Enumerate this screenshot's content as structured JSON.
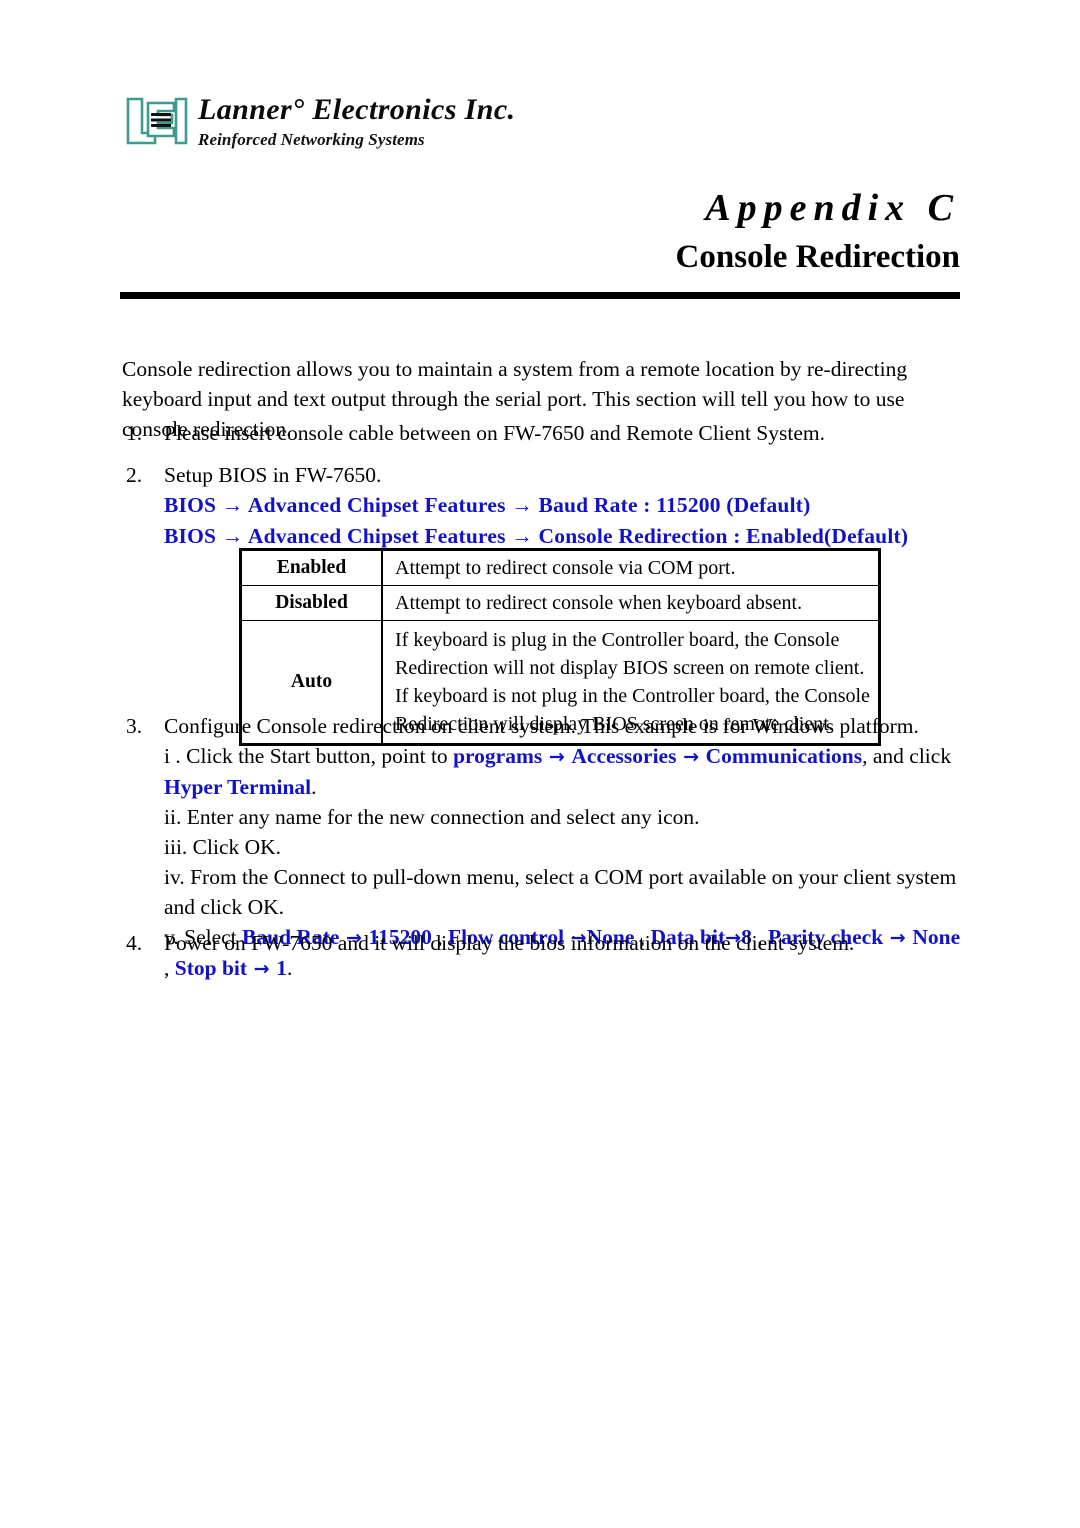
{
  "logo": {
    "mark_text": "LEI",
    "mark_color": "#3d9a8f",
    "company": "Lanner° Electronicѕ Inc.",
    "tagline": "Reinforced Networking Systems"
  },
  "header": {
    "appendix_title": "Appendix C",
    "subtitle": "Console Redirection"
  },
  "intro": "Console redirection allows you to maintain a system from a remote location by re-directing keyboard input and text output through the serial port. This section will tell you how to use console redirection.",
  "accent_blue": "#1111C9",
  "arrow_glyph": "→",
  "steps": [
    {
      "number": "1.",
      "text": "Please insert console cable between on FW-7650 and Remote Client System."
    },
    {
      "number": "2.",
      "text": "Setup BIOS in FW-7650.",
      "blue_lines": [
        "BIOS  → Advanced Chipset Features → Baud Rate : 115200 (Default)",
        "BIOS  → Advanced Chipset Features  → Console Redirection : Enabled(Default)"
      ]
    },
    {
      "number": "3.",
      "text": "Configure Console redirection on client system. This example is for Windows platform."
    },
    {
      "number": "4.",
      "text": "Power on FW-7650 and it will display the bios information on the client system."
    }
  ],
  "table": {
    "rows": [
      {
        "option": "Enabled",
        "description": "Attempt to redirect console via COM port."
      },
      {
        "option": "Disabled",
        "description": "Attempt to redirect console when keyboard absent."
      },
      {
        "option": "Auto",
        "description_lines": [
          "If keyboard is plug in the Controller board, the Console Redirection will not display BIOS screen on remote client.",
          "If keyboard is not plug in the Controller board, the Console Redirection will display BIOS screen on remote client."
        ]
      }
    ]
  },
  "substeps": {
    "i": {
      "marker": "i .",
      "lead": "Click the Start button, point to ",
      "link1": "programs",
      "link2": "Accessories",
      "link3": "Communications",
      "mid": ", and click ",
      "link4": "Hyper Terminal",
      "tail": "."
    },
    "ii": {
      "marker": "ii.",
      "text": "Enter any name for the new connection and select any icon."
    },
    "iii": {
      "marker": "iii.",
      "text": "Click OK."
    },
    "iv": {
      "marker": "iv.",
      "text": "From the Connect to pull-down menu, select a COM port available on your client system and click OK."
    },
    "v": {
      "marker": "v.",
      "lead": "Select ",
      "settings": [
        {
          "label": "Baud Rate",
          "value": "115200"
        },
        {
          "label": "Flow control",
          "value": "None"
        },
        {
          "label": "Data bit",
          "value": "8"
        },
        {
          "label": "Parity check",
          "value": "None"
        },
        {
          "label": "Stop bit",
          "value": "1"
        }
      ],
      "separator": " , ",
      "tail": "."
    }
  }
}
